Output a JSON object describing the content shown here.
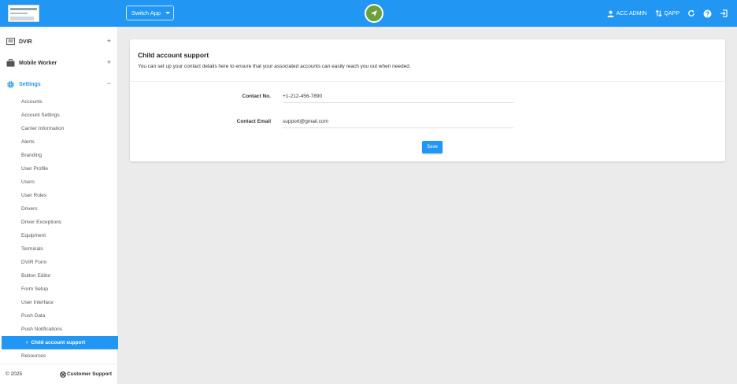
{
  "header": {
    "switch_app_label": "Switch App",
    "user_label": "ACC ADMIN",
    "app_label": "QAPP"
  },
  "sidebar": {
    "sections": [
      {
        "label": "DVIR",
        "toggle": "+"
      },
      {
        "label": "Mobile Worker",
        "toggle": "+"
      },
      {
        "label": "Settings",
        "toggle": "−"
      }
    ],
    "items": [
      {
        "label": "Accounts"
      },
      {
        "label": "Account Settings"
      },
      {
        "label": "Carrier Information"
      },
      {
        "label": "Alerts"
      },
      {
        "label": "Branding"
      },
      {
        "label": "User Profile"
      },
      {
        "label": "Users"
      },
      {
        "label": "User Roles"
      },
      {
        "label": "Drivers"
      },
      {
        "label": "Driver Exceptions"
      },
      {
        "label": "Equipment"
      },
      {
        "label": "Terminals"
      },
      {
        "label": "DVIR Form"
      },
      {
        "label": "Button Editor"
      },
      {
        "label": "Form Setup"
      },
      {
        "label": "User Interface"
      },
      {
        "label": "Push Data"
      },
      {
        "label": "Push Notifications"
      },
      {
        "label": "Child account support",
        "selected": true
      },
      {
        "label": "Resources"
      }
    ],
    "footer": {
      "copyright": "© 2025",
      "support_label": "Customer Support"
    }
  },
  "main": {
    "title": "Child account support",
    "subtitle": "You can set up your contact details here to ensure that your associated accounts can easily reach you out when needed.",
    "fields": {
      "contact_no_label": "Contact No.",
      "contact_no_value": "+1-212-456-7890",
      "contact_email_label": "Contact Email",
      "contact_email_value": "support@gmail.com"
    },
    "save_label": "Save"
  },
  "colors": {
    "primary": "#2196f3",
    "brand_green": "#6aa13a",
    "background": "#ebebeb"
  }
}
